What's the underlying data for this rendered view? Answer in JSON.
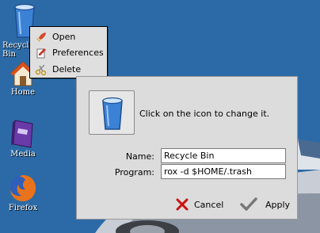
{
  "desktop": {
    "icons": [
      {
        "label": "Recycle Bin",
        "icon": "recycle-bin-icon"
      },
      {
        "label": "Home",
        "icon": "home-icon"
      },
      {
        "label": "Media",
        "icon": "media-icon"
      },
      {
        "label": "Firefox",
        "icon": "firefox-icon"
      }
    ]
  },
  "context_menu": {
    "items": [
      {
        "label": "Open",
        "icon": "rocket-icon"
      },
      {
        "label": "Preferences",
        "icon": "preferences-icon"
      },
      {
        "label": "Delete",
        "icon": "scissors-icon"
      }
    ]
  },
  "dialog": {
    "hint": "Click on the icon to change it.",
    "name_label": "Name:",
    "name_value": "Recycle Bin",
    "program_label": "Program:",
    "program_value": "rox -d $HOME/.trash",
    "cancel_label": "Cancel",
    "apply_label": "Apply"
  },
  "colors": {
    "desktop_background": "#2c6aa7",
    "dialog_background": "#dcdcdc",
    "cancel_icon": "#cc1111",
    "apply_icon": "#777777"
  }
}
